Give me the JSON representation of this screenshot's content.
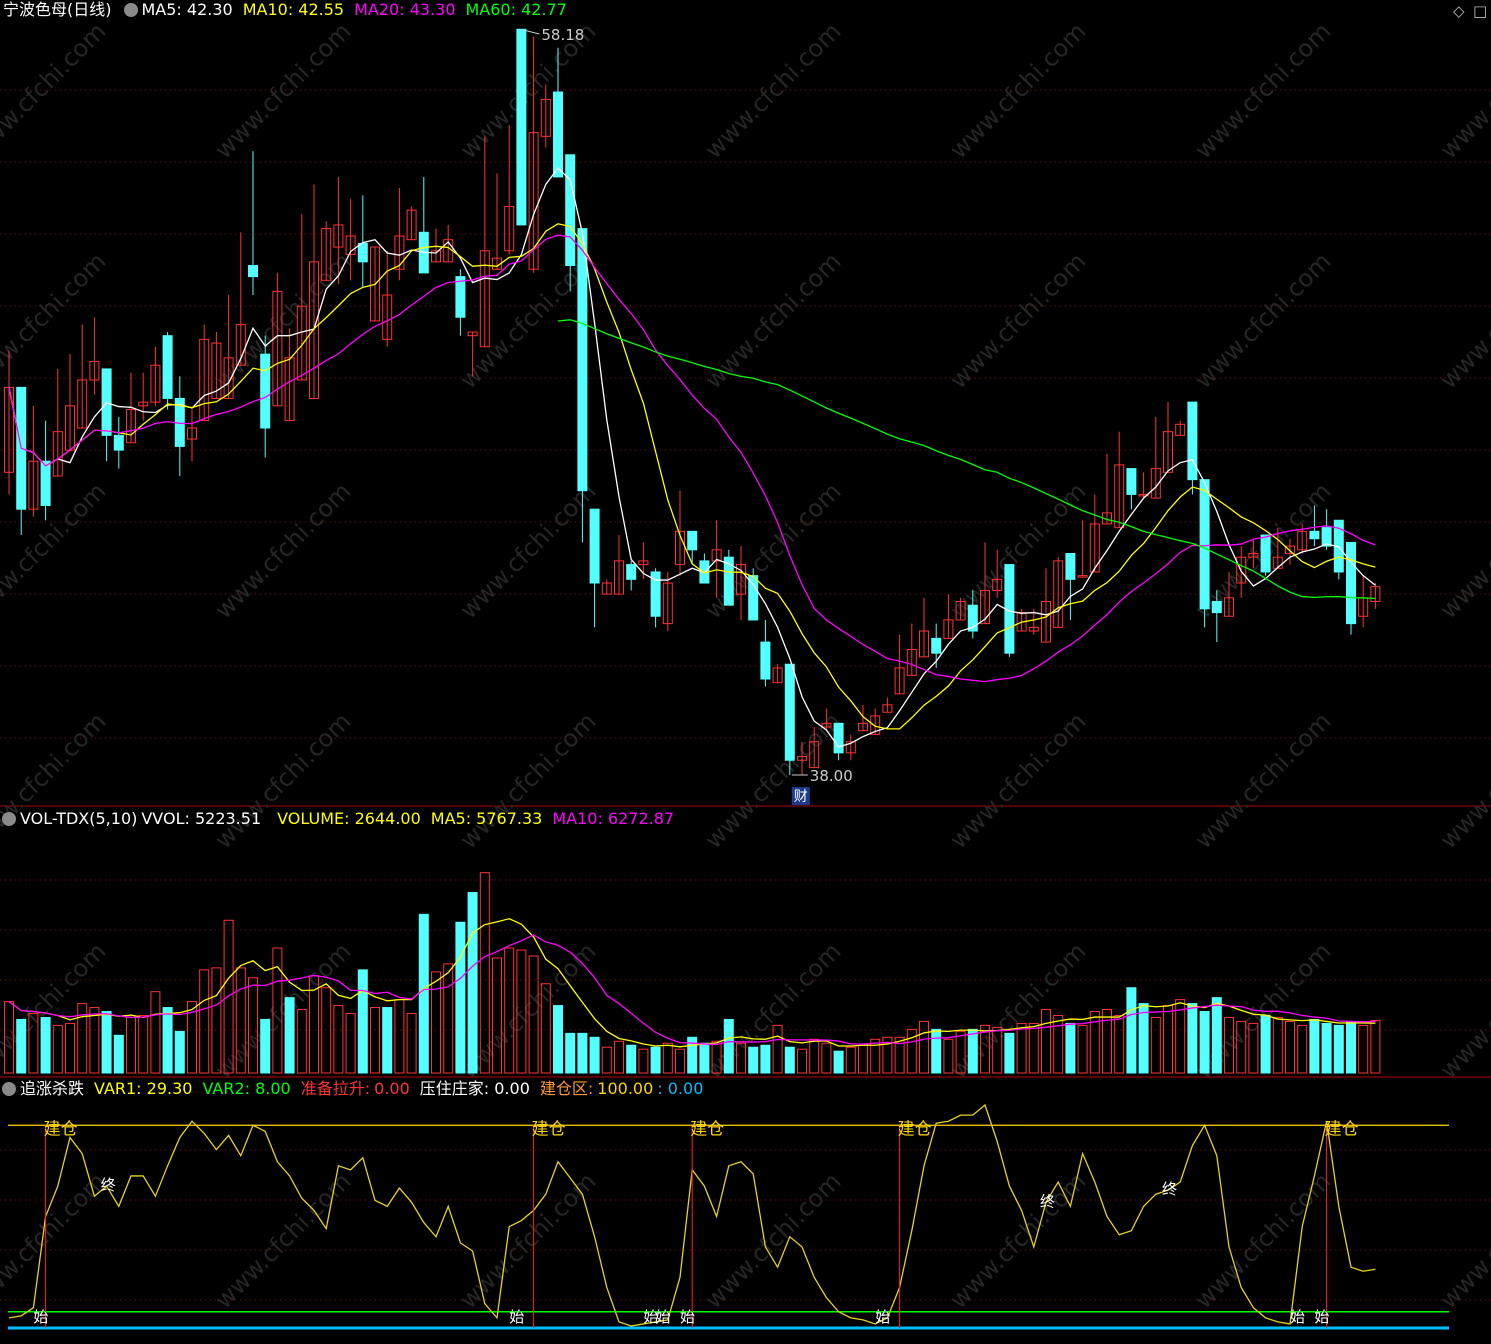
{
  "main_header": {
    "stock": "宁波色母(日线)",
    "ma5": "MA5: 42.30",
    "ma10": "MA10: 42.55",
    "ma20": "MA20: 43.30",
    "ma60": "MA60: 42.77"
  },
  "vol_header": {
    "name": "VOL-TDX(5,10)",
    "vvol": "VVOL: 5223.51",
    "volume": "VOLUME: 2644.00",
    "ma5": "MA5: 5767.33",
    "ma10": "MA10: 6272.87"
  },
  "ind_header": {
    "name": "追涨杀跌",
    "var1": "VAR1: 29.30",
    "var2": "VAR2: 8.00",
    "ready_label": "准备拉升:",
    "ready_value": "0.00",
    "press": "压住庄家: 0.00",
    "build_label": "建仓区:",
    "build_value": "100.00",
    "extra": ": 0.00"
  },
  "window_controls": {
    "restore": "◇",
    "more": "□"
  },
  "colors": {
    "up": "#ff3232",
    "down": "#54ffff",
    "ma5": "#ffffff",
    "ma10": "#ffff00",
    "ma20": "#ff00ff",
    "ma60": "#00ff00",
    "grid": "#8b0000",
    "divider": "#b40000"
  },
  "watermark": "www.cfchi.com",
  "chart_data": [
    {
      "type": "candlestick",
      "title": "宁波色母(日线)",
      "ylim": [
        36.5,
        59.5
      ],
      "annotations": [
        {
          "text": "58.18",
          "type": "high"
        },
        {
          "text": "38.00",
          "type": "low"
        },
        {
          "text": "财",
          "type": "marker"
        }
      ],
      "candles": [
        [
          46.2,
          48.5,
          49.5,
          45.6
        ],
        [
          48.5,
          45.2,
          48.5,
          44.5
        ],
        [
          45.2,
          46.5,
          48.0,
          45.0
        ],
        [
          46.5,
          45.3,
          47.6,
          44.9
        ],
        [
          46.1,
          47.3,
          49.0,
          46.1
        ],
        [
          46.8,
          48.0,
          49.4,
          46.8
        ],
        [
          47.4,
          48.7,
          50.2,
          47.4
        ],
        [
          48.7,
          49.2,
          50.4,
          48.3
        ],
        [
          49.0,
          47.2,
          49.0,
          46.5
        ],
        [
          47.2,
          46.8,
          47.7,
          46.3
        ],
        [
          47.0,
          47.9,
          48.9,
          47.0
        ],
        [
          48.0,
          48.1,
          48.9,
          47.6
        ],
        [
          48.1,
          49.1,
          49.6,
          48.0
        ],
        [
          49.9,
          48.2,
          50.0,
          47.9
        ],
        [
          48.2,
          46.9,
          48.8,
          46.1
        ],
        [
          47.1,
          47.4,
          47.9,
          46.5
        ],
        [
          47.6,
          49.8,
          50.2,
          47.6
        ],
        [
          48.2,
          49.7,
          50.0,
          48.2
        ],
        [
          48.2,
          49.3,
          51.0,
          48.2
        ],
        [
          49.1,
          50.2,
          52.7,
          49.1
        ],
        [
          51.8,
          51.5,
          54.9,
          51.0
        ],
        [
          49.4,
          47.4,
          49.9,
          46.6
        ],
        [
          48.0,
          51.1,
          51.6,
          48.0
        ],
        [
          47.6,
          49.3,
          50.1,
          47.6
        ],
        [
          48.7,
          50.7,
          53.2,
          48.7
        ],
        [
          48.2,
          51.9,
          54.0,
          48.2
        ],
        [
          51.4,
          52.8,
          53.0,
          51.4
        ],
        [
          52.3,
          52.9,
          54.2,
          51.3
        ],
        [
          52.1,
          52.6,
          53.6,
          51.4
        ],
        [
          52.4,
          51.9,
          53.7,
          51.2
        ],
        [
          50.3,
          52.3,
          52.3,
          50.3
        ],
        [
          49.8,
          51.0,
          52.2,
          49.6
        ],
        [
          51.7,
          52.6,
          53.9,
          51.4
        ],
        [
          52.5,
          53.3,
          53.4,
          52.5
        ],
        [
          52.7,
          51.6,
          54.2,
          51.6
        ],
        [
          51.9,
          52.2,
          52.8,
          51.9
        ],
        [
          51.9,
          52.5,
          52.9,
          51.9
        ],
        [
          51.5,
          50.4,
          51.7,
          49.9
        ],
        [
          49.9,
          50.0,
          50.0,
          48.8
        ],
        [
          49.6,
          52.2,
          55.3,
          49.6
        ],
        [
          51.7,
          52.0,
          54.3,
          51.7
        ],
        [
          52.2,
          53.4,
          55.6,
          52.1
        ],
        [
          58.2,
          52.9,
          58.2,
          52.9
        ],
        [
          51.7,
          55.4,
          58.0,
          51.6
        ],
        [
          55.3,
          56.3,
          56.7,
          55.0
        ],
        [
          56.5,
          54.2,
          57.7,
          54.2
        ],
        [
          54.8,
          51.8,
          54.8,
          51.1
        ],
        [
          52.8,
          45.7,
          52.8,
          44.3
        ],
        [
          45.2,
          43.2,
          45.2,
          42.0
        ],
        [
          42.9,
          43.2,
          43.3,
          42.9
        ],
        [
          42.9,
          43.8,
          44.5,
          42.9
        ],
        [
          43.7,
          43.3,
          43.8,
          43.0
        ],
        [
          43.7,
          43.8,
          44.3,
          43.3
        ],
        [
          43.5,
          42.3,
          43.6,
          42.0
        ],
        [
          42.1,
          43.2,
          43.5,
          41.9
        ],
        [
          43.7,
          44.6,
          45.7,
          43.4
        ],
        [
          44.6,
          44.1,
          44.6,
          43.7
        ],
        [
          43.8,
          43.2,
          44.0,
          43.2
        ],
        [
          43.8,
          44.1,
          44.9,
          42.8
        ],
        [
          43.9,
          42.6,
          44.1,
          42.6
        ],
        [
          42.9,
          43.7,
          44.2,
          42.2
        ],
        [
          43.4,
          42.2,
          43.6,
          42.2
        ],
        [
          41.6,
          40.6,
          42.2,
          40.4
        ],
        [
          40.5,
          40.9,
          41.0,
          40.5
        ],
        [
          41.0,
          38.4,
          41.0,
          38.0
        ],
        [
          38.4,
          38.5,
          38.9,
          38.0
        ],
        [
          38.2,
          38.9,
          39.3,
          38.2
        ],
        [
          39.3,
          39.4,
          39.8,
          39.2
        ],
        [
          39.4,
          38.6,
          39.4,
          38.4
        ],
        [
          38.6,
          38.9,
          39.1,
          38.4
        ],
        [
          39.2,
          39.4,
          39.9,
          39.2
        ],
        [
          39.1,
          39.6,
          39.8,
          39.1
        ],
        [
          39.7,
          39.9,
          40.1,
          39.7
        ],
        [
          40.2,
          40.9,
          41.8,
          40.2
        ],
        [
          40.7,
          41.4,
          42.1,
          40.7
        ],
        [
          41.2,
          41.9,
          42.8,
          41.2
        ],
        [
          41.7,
          41.3,
          42.1,
          40.9
        ],
        [
          41.7,
          42.2,
          42.9,
          41.7
        ],
        [
          42.2,
          42.7,
          42.8,
          42.2
        ],
        [
          42.6,
          41.9,
          43.0,
          41.7
        ],
        [
          42.1,
          43.0,
          44.3,
          42.1
        ],
        [
          43.0,
          43.3,
          44.1,
          42.8
        ],
        [
          43.7,
          41.3,
          43.7,
          41.2
        ],
        [
          41.9,
          42.4,
          42.5,
          41.9
        ],
        [
          41.9,
          42.0,
          42.5,
          41.8
        ],
        [
          41.6,
          42.7,
          43.6,
          41.6
        ],
        [
          42.0,
          43.8,
          43.9,
          42.0
        ],
        [
          44.0,
          43.3,
          44.0,
          42.2
        ],
        [
          43.4,
          43.4,
          44.9,
          43.4
        ],
        [
          43.5,
          44.8,
          45.6,
          43.5
        ],
        [
          44.8,
          45.1,
          46.7,
          44.8
        ],
        [
          44.7,
          46.4,
          47.3,
          44.7
        ],
        [
          46.3,
          45.6,
          46.3,
          45.2
        ],
        [
          45.6,
          45.6,
          46.2,
          45.5
        ],
        [
          45.5,
          46.3,
          47.7,
          45.5
        ],
        [
          46.2,
          47.3,
          48.1,
          46.2
        ],
        [
          47.2,
          47.5,
          47.6,
          47.2
        ],
        [
          48.1,
          46.0,
          48.1,
          45.6
        ],
        [
          46.0,
          42.5,
          46.0,
          42.0
        ],
        [
          42.7,
          42.4,
          43.0,
          41.6
        ],
        [
          42.3,
          42.8,
          43.5,
          42.3
        ],
        [
          43.2,
          43.9,
          44.2,
          42.8
        ],
        [
          43.9,
          44.0,
          44.4,
          43.6
        ],
        [
          44.5,
          43.5,
          44.5,
          43.4
        ],
        [
          43.6,
          43.9,
          44.7,
          43.6
        ],
        [
          44.0,
          44.2,
          44.4,
          43.7
        ],
        [
          44.1,
          44.6,
          44.8,
          44.0
        ],
        [
          44.6,
          44.4,
          45.3,
          44.2
        ],
        [
          44.7,
          44.2,
          45.2,
          44.1
        ],
        [
          44.9,
          43.5,
          44.9,
          43.3
        ],
        [
          44.3,
          42.1,
          44.3,
          41.8
        ],
        [
          42.3,
          42.8,
          43.4,
          42.0
        ],
        [
          42.7,
          43.1,
          43.2,
          42.5
        ]
      ]
    },
    {
      "type": "bar",
      "title": "VOL-TDX(5,10)",
      "ylim": [
        0,
        12000
      ],
      "values": [
        3600,
        2700,
        3000,
        2800,
        2400,
        2500,
        3500,
        3300,
        3100,
        1900,
        2800,
        2900,
        4100,
        3300,
        2100,
        3600,
        5200,
        5300,
        7700,
        5300,
        4800,
        2700,
        6300,
        3800,
        3200,
        4900,
        4300,
        3400,
        3000,
        5200,
        3300,
        3300,
        3700,
        3000,
        8000,
        5100,
        5500,
        7600,
        9100,
        10100,
        5800,
        6300,
        6200,
        5900,
        4500,
        3400,
        2000,
        2000,
        1800,
        1300,
        1600,
        1400,
        1200,
        1300,
        1500,
        1200,
        1800,
        1500,
        1600,
        2700,
        1500,
        1300,
        1400,
        2400,
        1300,
        1200,
        1700,
        1500,
        1100,
        1300,
        1400,
        1700,
        1800,
        1800,
        2200,
        2600,
        2200,
        1700,
        2100,
        2200,
        2400,
        2300,
        2000,
        2500,
        2500,
        3200,
        2900,
        2500,
        2400,
        3100,
        3200,
        2900,
        4300,
        3500,
        2800,
        3400,
        3700,
        3500,
        3100,
        3800,
        2800,
        2600,
        2500,
        2900,
        2800,
        2600,
        2400,
        2700,
        2500,
        2400,
        2600,
        2400,
        2644
      ],
      "up": [
        1,
        0,
        1,
        0,
        1,
        1,
        1,
        1,
        0,
        0,
        1,
        1,
        1,
        0,
        0,
        1,
        1,
        1,
        1,
        1,
        1,
        0,
        1,
        0,
        1,
        1,
        1,
        1,
        1,
        0,
        1,
        0,
        1,
        1,
        0,
        1,
        1,
        0,
        0,
        1,
        1,
        1,
        1,
        1,
        1,
        0,
        0,
        0,
        0,
        1,
        1,
        0,
        1,
        0,
        1,
        1,
        0,
        0,
        1,
        0,
        1,
        0,
        0,
        1,
        0,
        1,
        1,
        1,
        0,
        1,
        1,
        1,
        1,
        1,
        1,
        1,
        0,
        1,
        1,
        0,
        1,
        1,
        0,
        1,
        1,
        1,
        1,
        0,
        1,
        1,
        1,
        1,
        0,
        0,
        1,
        1,
        1,
        0,
        0,
        0,
        1,
        1,
        1,
        0,
        1,
        1,
        1,
        0,
        0,
        0,
        0,
        1,
        1
      ]
    },
    {
      "type": "line",
      "title": "追涨杀跌",
      "ylim": [
        0,
        110
      ],
      "series": [
        {
          "name": "VAR1",
          "values": [
            5,
            6,
            10,
            55,
            70,
            94,
            86,
            65,
            70,
            60,
            75,
            75,
            65,
            80,
            94,
            102,
            96,
            88,
            95,
            85,
            100,
            97,
            82,
            75,
            64,
            58,
            49,
            80,
            78,
            84,
            63,
            60,
            69,
            62,
            52,
            45,
            60,
            42,
            38,
            12,
            5,
            50,
            53,
            58,
            66,
            82,
            74,
            66,
            45,
            20,
            3,
            1,
            2,
            3,
            4,
            25,
            78,
            70,
            55,
            80,
            82,
            76,
            40,
            30,
            45,
            40,
            25,
            15,
            8,
            5,
            4,
            2,
            5,
            20,
            48,
            80,
            101,
            102,
            105,
            105,
            110,
            92,
            70,
            58,
            40,
            62,
            72,
            60,
            86,
            72,
            55,
            46,
            48,
            60,
            66,
            68,
            72,
            90,
            100,
            85,
            40,
            20,
            10,
            5,
            3,
            2,
            50,
            75,
            102,
            60,
            30,
            28,
            29
          ]
        },
        {
          "name": "VAR2",
          "values": [
            8
          ]
        },
        {
          "name": "建仓区",
          "values": [
            100
          ]
        }
      ],
      "labels": [
        "建仓",
        "始",
        "终"
      ]
    }
  ]
}
